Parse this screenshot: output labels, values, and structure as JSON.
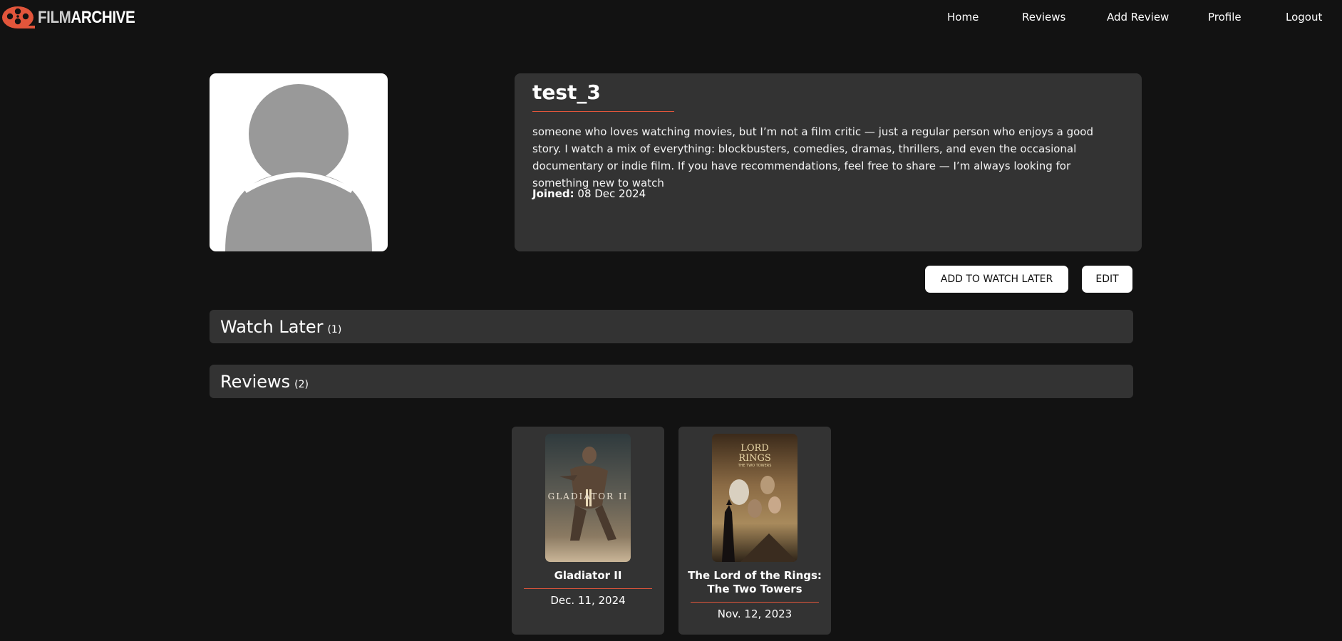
{
  "brand": {
    "part1": "FILM",
    "part2": "ARCHIVE",
    "accent": "#e2553b"
  },
  "nav": {
    "home": "Home",
    "reviews": "Reviews",
    "add_review": "Add Review",
    "profile": "Profile",
    "logout": "Logout"
  },
  "profile": {
    "username": "test_3",
    "bio": "someone who loves watching movies, but I’m not a film critic — just a regular person who enjoys a good story. I watch a mix of everything: blockbusters, comedies, dramas, thrillers, and even the occasional documentary or indie film. If you have recommendations, feel free to share — I’m always looking for something new to watch",
    "joined_label": "Joined:",
    "joined_date": "08 Dec 2024",
    "avatar_icon": "user-placeholder-icon"
  },
  "actions": {
    "watch_later": "ADD TO WATCH LATER",
    "edit": "EDIT"
  },
  "sections": {
    "watch_later": {
      "title": "Watch Later",
      "count": "(1)"
    },
    "reviews": {
      "title": "Reviews",
      "count": "(2)"
    }
  },
  "reviews": [
    {
      "title": "Gladiator II",
      "date": "Dec. 11, 2024",
      "poster_text": "GLADIATOR II"
    },
    {
      "title_line1": "The Lord of the Rings:",
      "title_line2": "The Two Towers",
      "date": "Nov. 12, 2023",
      "poster_text_1": "LORD",
      "poster_text_2": "RINGS",
      "poster_text_small": "THE TWO TOWERS"
    }
  ]
}
